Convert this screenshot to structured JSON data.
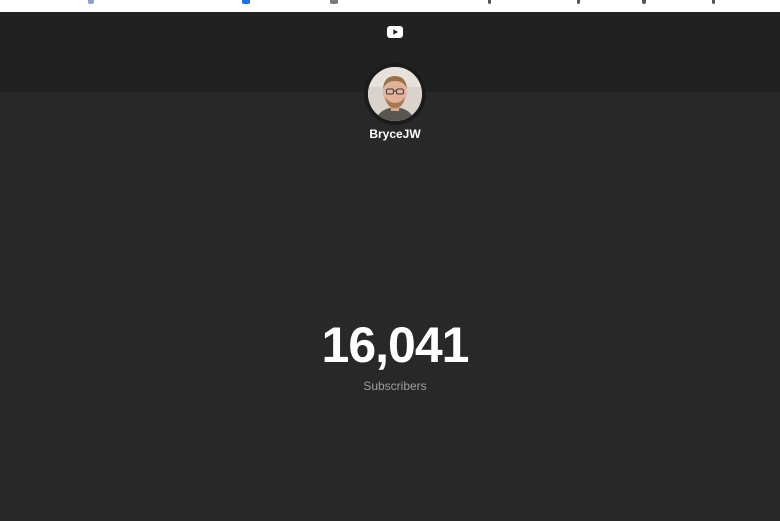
{
  "header": {
    "logo_icon": "youtube-icon"
  },
  "channel": {
    "avatar_icon": "channel-avatar",
    "name": "BryceJW"
  },
  "stats": {
    "subscriber_count": "16,041",
    "subscriber_label": "Subscribers"
  },
  "colors": {
    "background": "#282828",
    "header_background": "#212121",
    "text_primary": "#ffffff",
    "text_secondary": "#9e9e9e"
  }
}
